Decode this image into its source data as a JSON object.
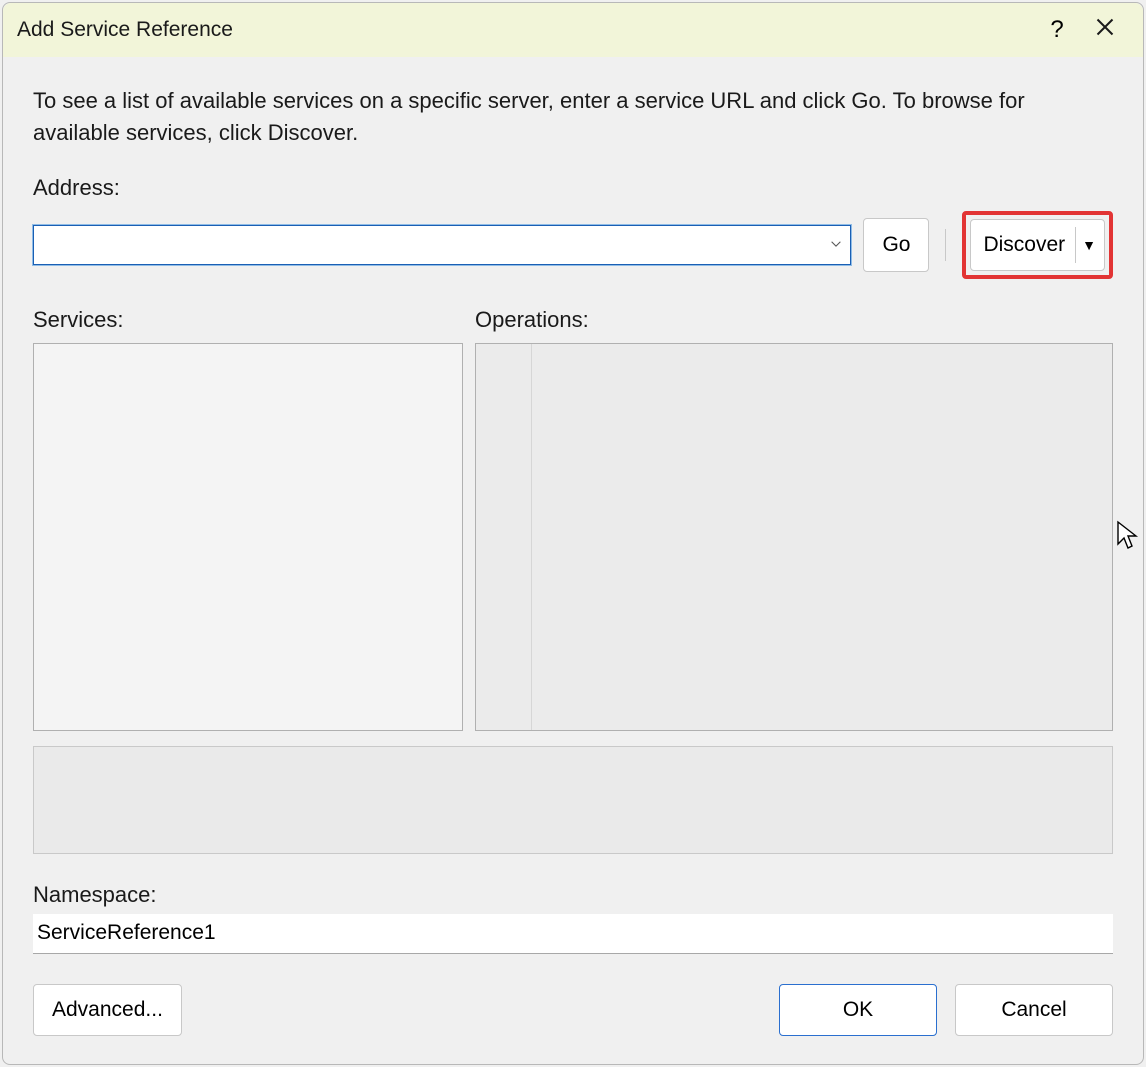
{
  "titlebar": {
    "title": "Add Service Reference",
    "help_icon": "?",
    "close_icon": "✕"
  },
  "instructions": "To see a list of available services on a specific server, enter a service URL and click Go. To browse for available services, click Discover.",
  "address": {
    "label": "Address:",
    "value": ""
  },
  "buttons": {
    "go": "Go",
    "discover": "Discover",
    "advanced": "Advanced...",
    "ok": "OK",
    "cancel": "Cancel"
  },
  "services": {
    "label": "Services:",
    "items": []
  },
  "operations": {
    "label": "Operations:",
    "items": []
  },
  "status": {
    "text": ""
  },
  "namespace": {
    "label": "Namespace:",
    "value": "ServiceReference1"
  },
  "highlight": {
    "target": "discover-button",
    "color": "#e23434"
  }
}
